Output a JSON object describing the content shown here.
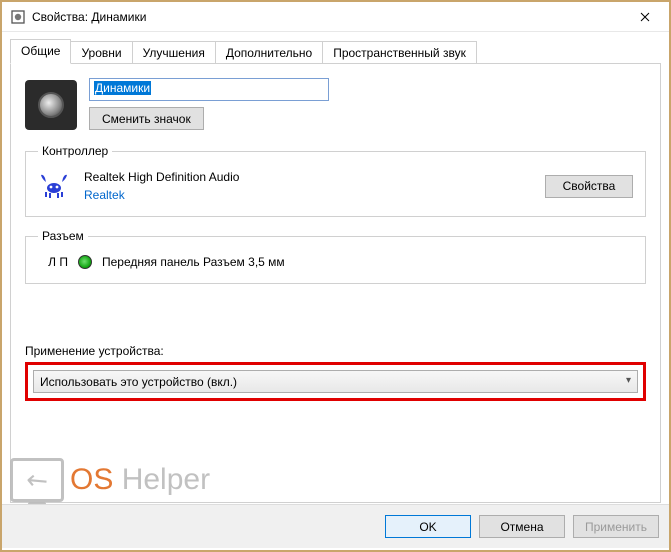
{
  "window": {
    "title": "Свойства: Динамики"
  },
  "tabs": {
    "items": [
      "Общие",
      "Уровни",
      "Улучшения",
      "Дополнительно",
      "Пространственный звук"
    ],
    "active": 0
  },
  "general": {
    "name_value": "Динамики",
    "change_icon_btn": "Сменить значок"
  },
  "controller": {
    "legend": "Контроллер",
    "name": "Realtek High Definition Audio",
    "vendor": "Realtek",
    "properties_btn": "Свойства"
  },
  "jack": {
    "legend": "Разъем",
    "lp": "Л П",
    "desc": "Передняя панель Разъем 3,5 мм"
  },
  "usage": {
    "label": "Применение устройства:",
    "selected": "Использовать это устройство (вкл.)"
  },
  "footer": {
    "ok": "OK",
    "cancel": "Отмена",
    "apply": "Применить"
  },
  "watermark": {
    "a": "OS",
    "b": " Helper"
  }
}
